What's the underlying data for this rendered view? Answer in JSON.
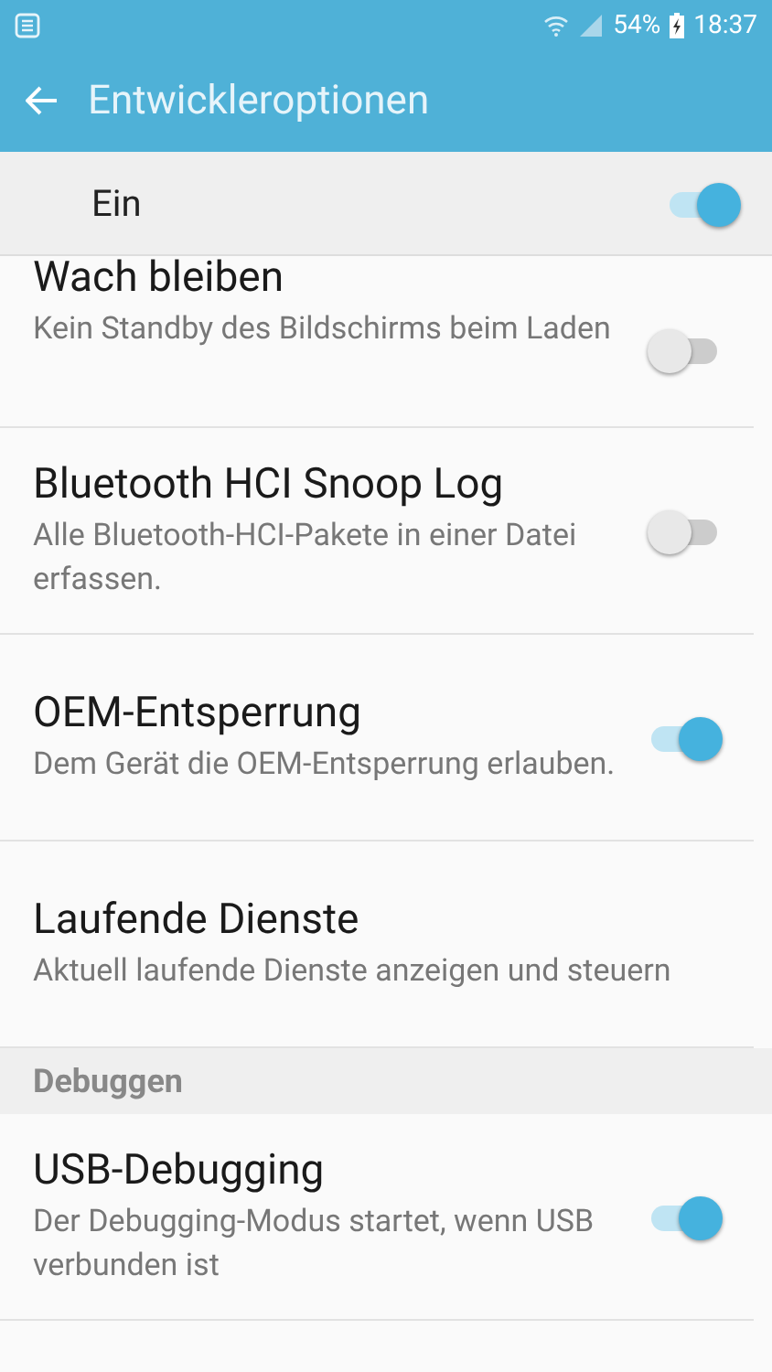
{
  "status_bar": {
    "battery": "54%",
    "time": "18:37"
  },
  "app_bar": {
    "title": "Entwickleroptionen"
  },
  "master": {
    "label": "Ein",
    "on": true
  },
  "items": [
    {
      "kind": "switch",
      "title": "Wach bleiben",
      "summary": "Kein Standby des Bildschirms beim Laden",
      "on": false
    },
    {
      "kind": "switch",
      "title": "Bluetooth HCI Snoop Log",
      "summary": "Alle Bluetooth-HCI-Pakete in einer Datei erfassen.",
      "on": false
    },
    {
      "kind": "switch",
      "title": "OEM-Entsperrung",
      "summary": "Dem Gerät die OEM-Entsperrung erlauben.",
      "on": true
    },
    {
      "kind": "plain",
      "title": "Laufende Dienste",
      "summary": "Aktuell laufende Dienste anzeigen und steuern"
    },
    {
      "kind": "header",
      "title": "Debuggen"
    },
    {
      "kind": "switch",
      "title": "USB-Debugging",
      "summary": "Der Debugging-Modus startet, wenn USB verbunden ist",
      "on": true
    }
  ]
}
